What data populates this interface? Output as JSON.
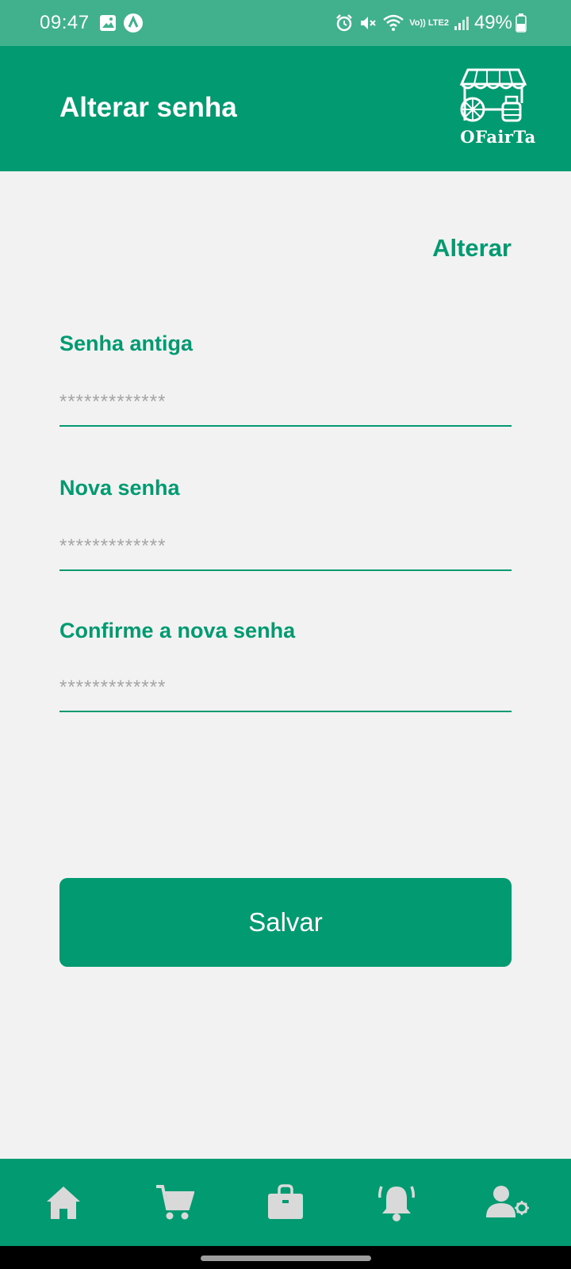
{
  "status_bar": {
    "time": "09:47",
    "network": "Vo)) LTE2",
    "battery": "49%",
    "left_icons": [
      "image-icon",
      "app-notification-icon"
    ],
    "right_icons": [
      "alarm-icon",
      "mute-icon",
      "wifi-icon",
      "signal-icon",
      "battery-icon"
    ]
  },
  "header": {
    "title": "Alterar senha",
    "logo_text": "OFairTa",
    "background": "#029a70"
  },
  "content": {
    "change_link": "Alterar",
    "fields": [
      {
        "label": "Senha antiga",
        "placeholder": "*************"
      },
      {
        "label": "Nova senha",
        "placeholder": "*************"
      },
      {
        "label": "Confirme a nova senha",
        "placeholder": "*************"
      }
    ],
    "save_label": "Salvar"
  },
  "bottom_nav": {
    "items": [
      "home-icon",
      "cart-icon",
      "shopping-bag-icon",
      "bell-icon",
      "user-settings-icon"
    ]
  },
  "colors": {
    "primary": "#029a70",
    "status_bar": "#41b08c",
    "background": "#f2f2f2",
    "nav_icon": "#d9d9d9"
  }
}
